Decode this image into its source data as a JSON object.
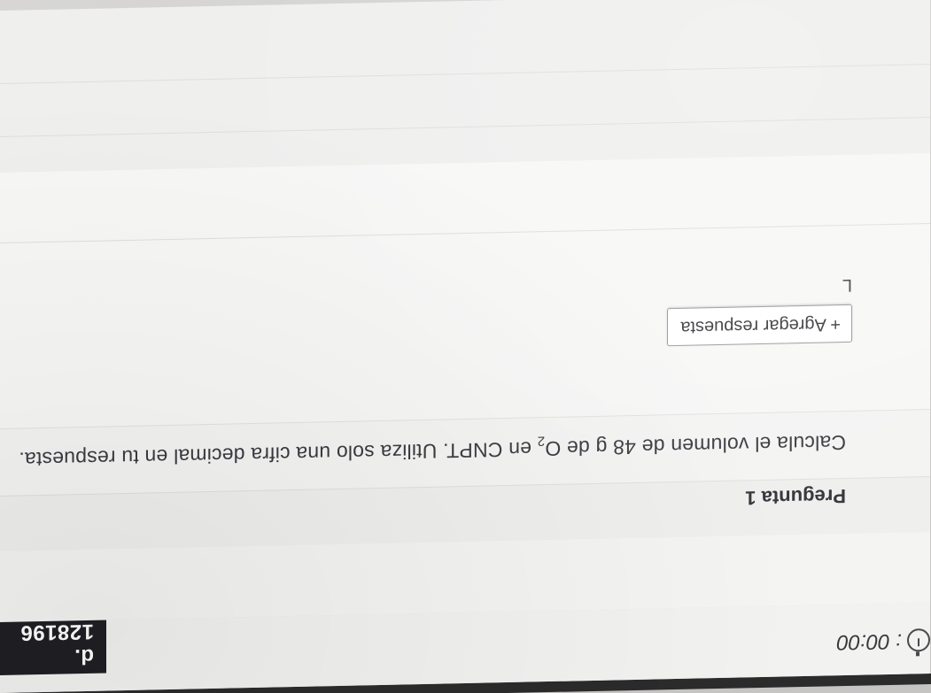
{
  "header": {
    "exam_id": "d. 128196",
    "timer_value": ": 00:00",
    "timer_icon": "stopwatch-icon"
  },
  "question": {
    "title": "Pregunta 1",
    "text_before_formula": "Calcula el volumen de 48 g de O",
    "formula_subscript": "2",
    "text_after_formula": " en CNPT. Utiliza solo una cifra decimal en tu respuesta."
  },
  "answer": {
    "add_answer_label": "+ Agregar respuesta",
    "unit": "L"
  }
}
